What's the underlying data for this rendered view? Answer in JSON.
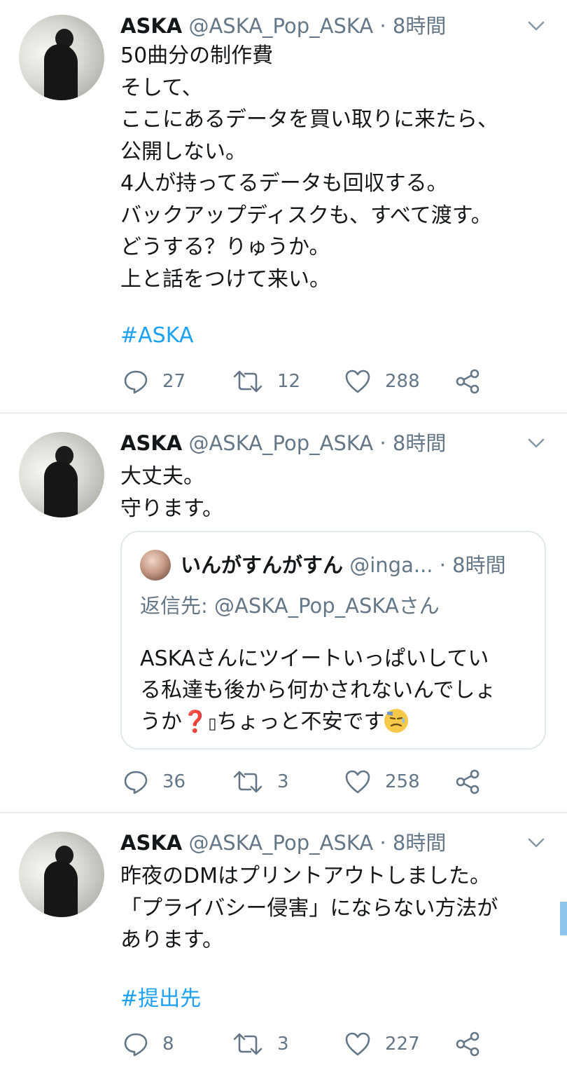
{
  "tweets": [
    {
      "author_name": "ASKA",
      "author_handle": "@ASKA_Pop_ASKA",
      "time": "8時間",
      "text_lines": [
        "50曲分の制作費",
        "そして、",
        "ここにあるデータを買い取りに来たら、",
        "公開しない。",
        "4人が持ってるデータも回収する。",
        "バックアップディスクも、すべて渡す。",
        "どうする？りゅうか。",
        "上と話をつけて来い。"
      ],
      "hashtag": "#ASKA",
      "reply_count": "27",
      "retweet_count": "12",
      "like_count": "288"
    },
    {
      "author_name": "ASKA",
      "author_handle": "@ASKA_Pop_ASKA",
      "time": "8時間",
      "text_lines": [
        "大丈夫。",
        "守ります。"
      ],
      "quote": {
        "author_name": "いんがすんがすん",
        "author_handle": "@inga...",
        "time": "8時間",
        "reply_to": "返信先: @ASKA_Pop_ASKAさん",
        "text_lines": [
          "ASKAさんにツイートいっぱいしてい",
          "る私達も後から何かされないんでしょ",
          "うか",
          "ちょっと不安です"
        ],
        "emoji_1": "❓",
        "emoji_2": "▯"
      },
      "reply_count": "36",
      "retweet_count": "3",
      "like_count": "258"
    },
    {
      "author_name": "ASKA",
      "author_handle": "@ASKA_Pop_ASKA",
      "time": "8時間",
      "text_lines": [
        "昨夜のDMはプリントアウトしました。",
        "「プライバシー侵害」にならない方法が",
        "あります。"
      ],
      "hashtag": "#提出先",
      "reply_count": "8",
      "retweet_count": "3",
      "like_count": "227"
    }
  ],
  "separator": "·",
  "icons": {
    "reply": "speech-bubble-icon",
    "retweet": "retweet-arrows-icon",
    "like": "heart-icon",
    "share": "share-nodes-icon",
    "more": "chevron-down-icon"
  },
  "colors": {
    "link": "#1da1f2",
    "secondary_text": "#657786",
    "divider": "#e6ecf0"
  }
}
